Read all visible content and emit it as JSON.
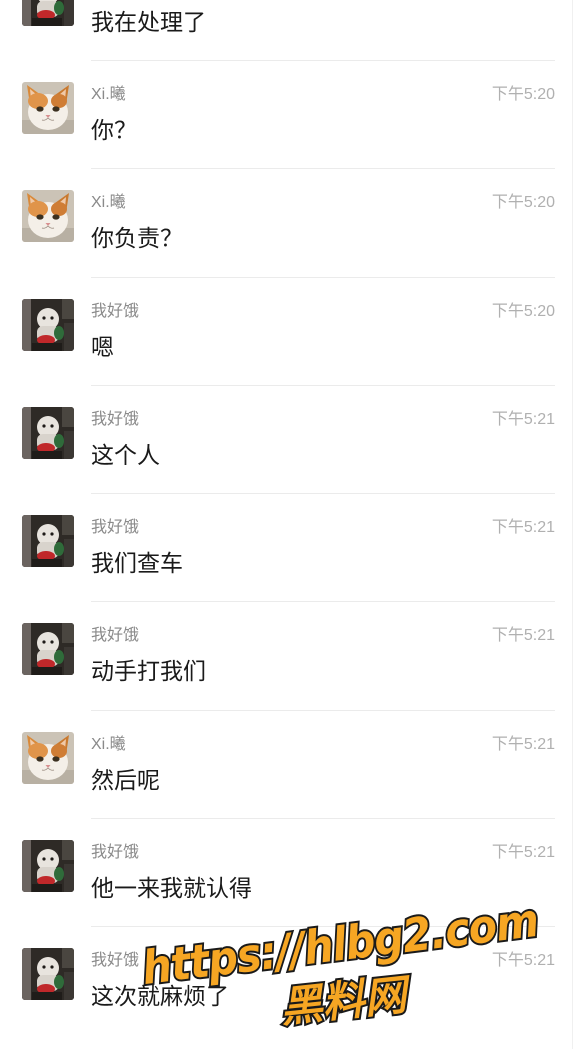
{
  "messages": [
    {
      "avatar": "plush-photo",
      "text": "我在处理了"
    },
    {
      "avatar": "cat-photo",
      "sender": "Xi.曦",
      "time": "下午5:20",
      "text": "你？"
    },
    {
      "avatar": "cat-photo",
      "sender": "Xi.曦",
      "time": "下午5:20",
      "text": "你负责？"
    },
    {
      "avatar": "plush-photo",
      "sender": "我好饿",
      "time": "下午5:20",
      "text": "嗯"
    },
    {
      "avatar": "plush-photo",
      "sender": "我好饿",
      "time": "下午5:21",
      "text": "这个人"
    },
    {
      "avatar": "plush-photo",
      "sender": "我好饿",
      "time": "下午5:21",
      "text": "我们查车"
    },
    {
      "avatar": "plush-photo",
      "sender": "我好饿",
      "time": "下午5:21",
      "text": "动手打我们"
    },
    {
      "avatar": "cat-photo",
      "sender": "Xi.曦",
      "time": "下午5:21",
      "text": "然后呢"
    },
    {
      "avatar": "plush-photo",
      "sender": "我好饿",
      "time": "下午5:21",
      "text": "他一来我就认得"
    },
    {
      "avatar": "plush-photo",
      "sender": "我好饿",
      "time": "下午5:21",
      "text": "这次就麻烦了"
    }
  ],
  "watermark": {
    "url": "https://hlbg2.com",
    "site_name": "黑料网"
  },
  "colors": {
    "background": "#ffffff",
    "message_text": "#1a1a1a",
    "sender_name": "#8a8a8a",
    "timestamp": "#b0b0b0",
    "divider": "#ebebeb",
    "watermark_fill": "#f6a623"
  }
}
